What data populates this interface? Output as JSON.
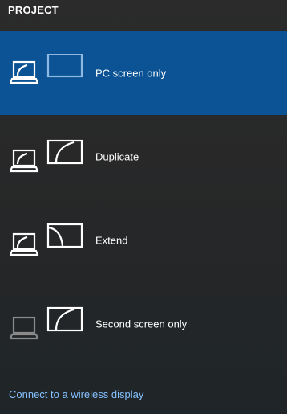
{
  "header": {
    "title": "PROJECT"
  },
  "options": [
    {
      "label": "PC screen only",
      "selected": true,
      "icon": "pc-screen-only-icon"
    },
    {
      "label": "Duplicate",
      "selected": false,
      "icon": "duplicate-icon"
    },
    {
      "label": "Extend",
      "selected": false,
      "icon": "extend-icon"
    },
    {
      "label": "Second screen only",
      "selected": false,
      "icon": "second-screen-only-icon"
    }
  ],
  "footer": {
    "link_label": "Connect to a wireless display"
  },
  "colors": {
    "selected_background": "#0b5394",
    "link": "#86c1ff",
    "dim_icon": "#8a8a8a"
  }
}
